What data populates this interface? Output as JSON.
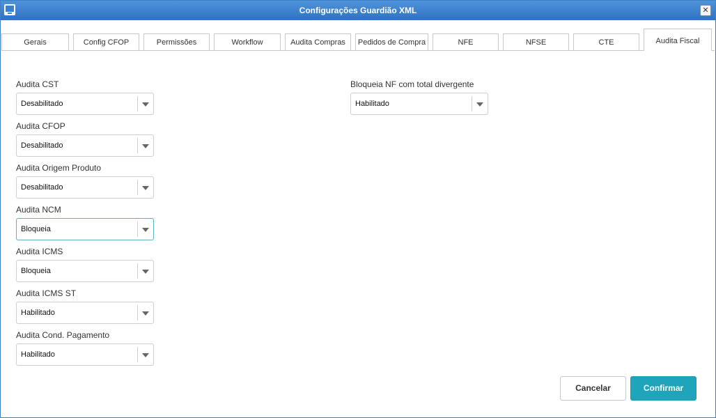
{
  "window": {
    "title": "Configurações Guardião XML",
    "close_glyph": "✕"
  },
  "tabs": [
    {
      "label": "Gerais"
    },
    {
      "label": "Config CFOP"
    },
    {
      "label": "Permissões"
    },
    {
      "label": "Workflow"
    },
    {
      "label": "Audita Compras"
    },
    {
      "label": "Pedidos de Compra"
    },
    {
      "label": "NFE"
    },
    {
      "label": "NFSE"
    },
    {
      "label": "CTE"
    },
    {
      "label": "Audita Fiscal",
      "active": true
    }
  ],
  "fields": {
    "audita_cst": {
      "label": "Audita CST",
      "value": "Desabilitado"
    },
    "audita_cfop": {
      "label": "Audita CFOP",
      "value": "Desabilitado"
    },
    "audita_origem_produto": {
      "label": "Audita Origem Produto",
      "value": "Desabilitado"
    },
    "audita_ncm": {
      "label": "Audita NCM",
      "value": "Bloqueia"
    },
    "audita_icms": {
      "label": "Audita ICMS",
      "value": "Bloqueia"
    },
    "audita_icms_st": {
      "label": "Audita ICMS ST",
      "value": "Habilitado"
    },
    "audita_cond_pagamento": {
      "label": "Audita Cond. Pagamento",
      "value": "Habilitado"
    },
    "bloqueia_nf_total_divergente": {
      "label": "Bloqueia NF com total divergente",
      "value": "Habilitado"
    }
  },
  "buttons": {
    "cancel": "Cancelar",
    "confirm": "Confirmar"
  },
  "colors": {
    "titlebar": "#2f73c0",
    "accent": "#1fa5bb",
    "focus_border": "#5fb1c4"
  },
  "icons": {
    "app": "app-window-icon",
    "close": "close-icon",
    "dropdown": "caret-down-icon"
  }
}
